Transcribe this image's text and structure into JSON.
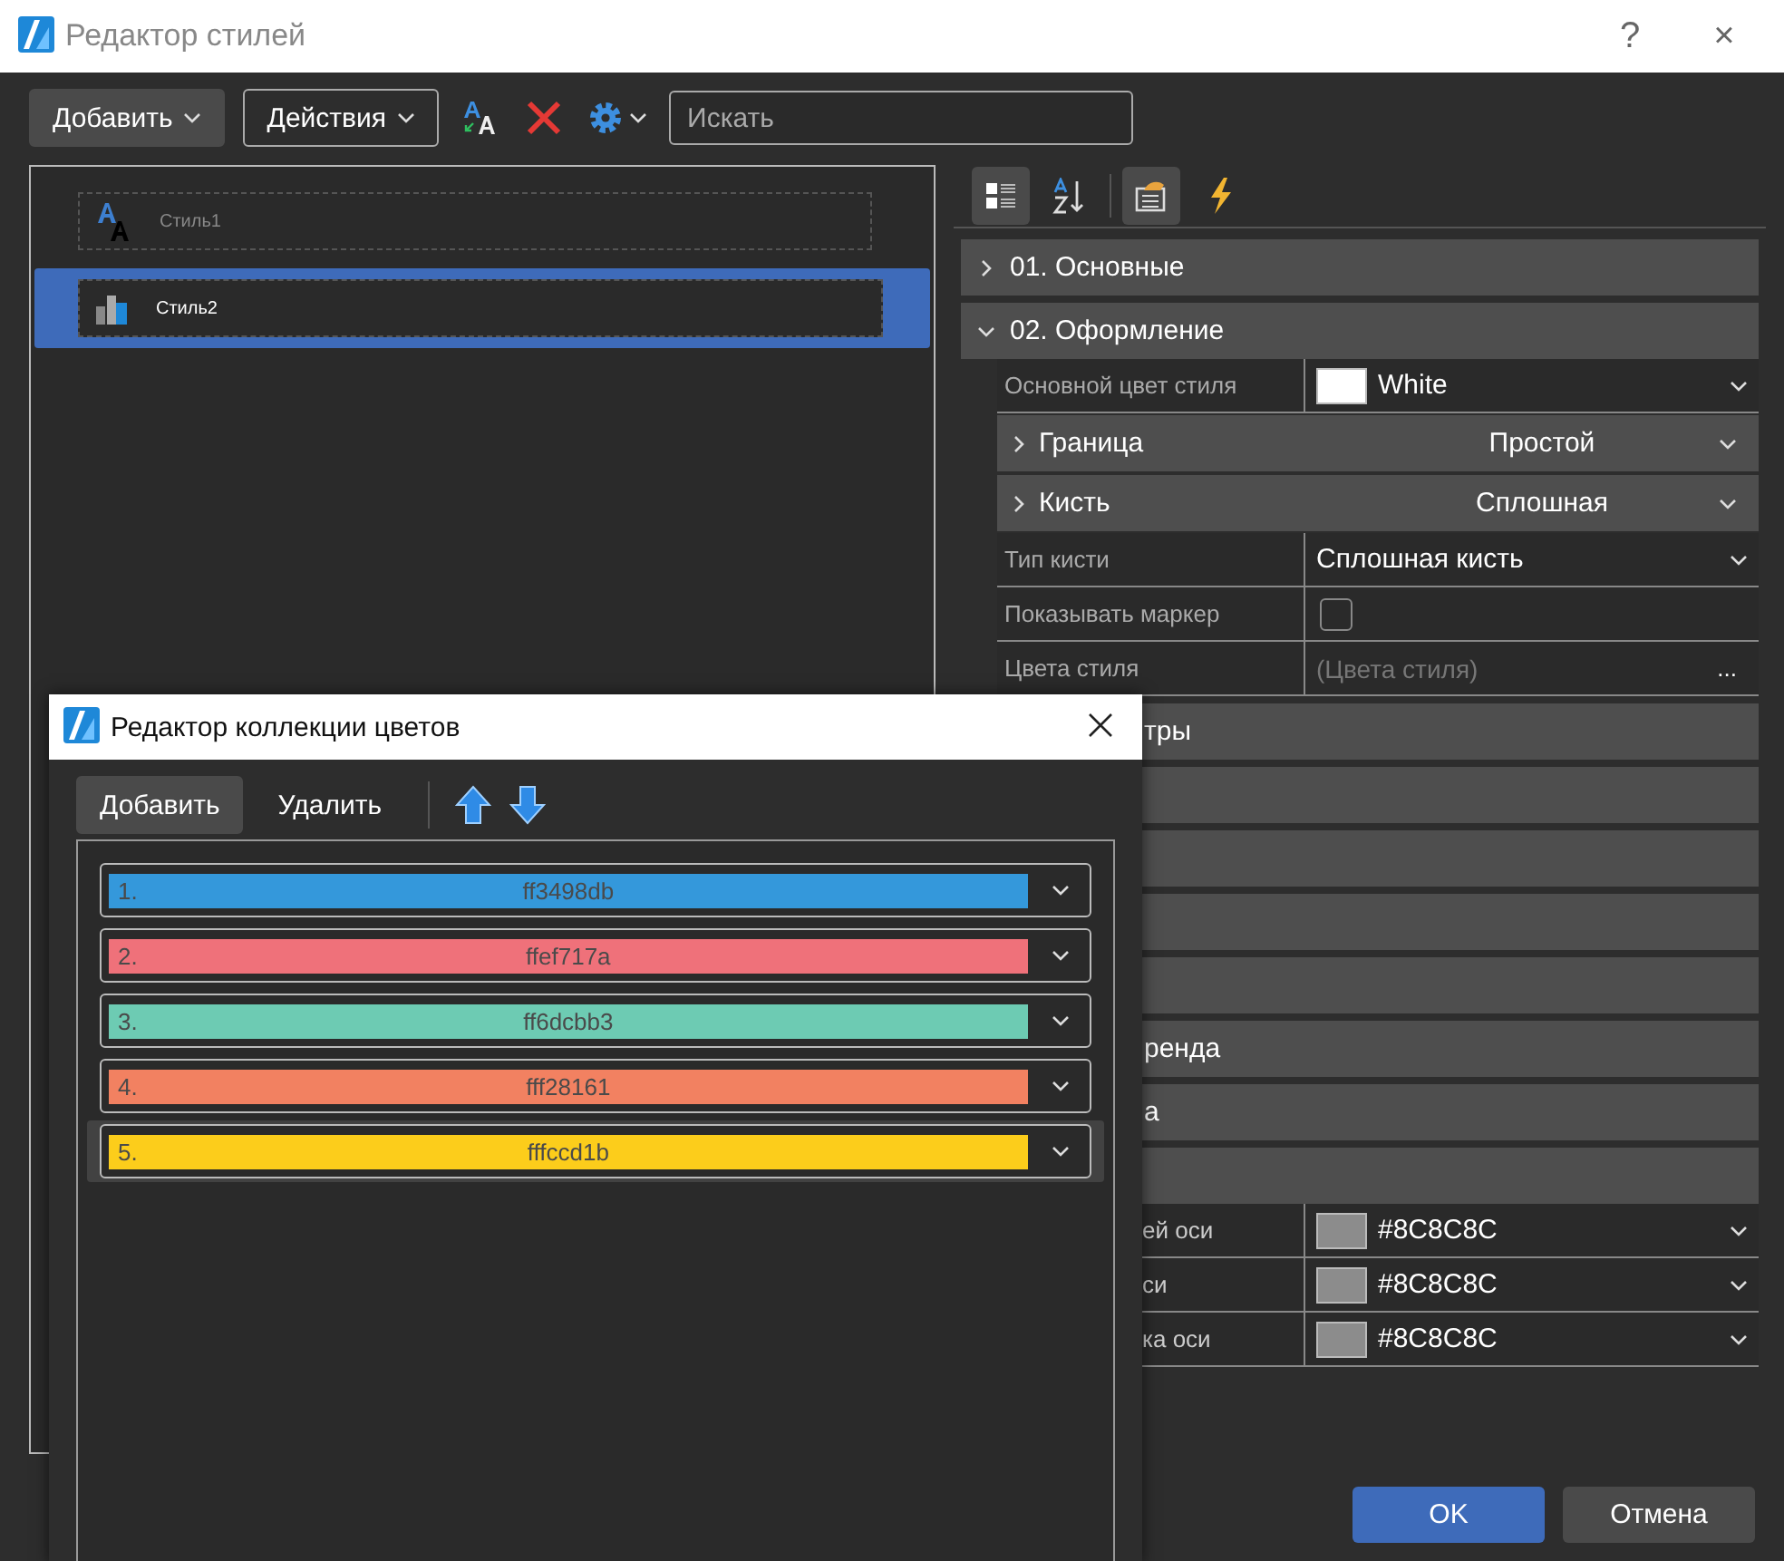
{
  "window": {
    "title": "Редактор стилей",
    "help": "?",
    "close": "×"
  },
  "toolbar": {
    "add": "Добавить",
    "actions": "Действия",
    "search": {
      "placeholder": "Искать"
    }
  },
  "styles": [
    {
      "name": "Стиль1",
      "kind": "text",
      "selected": false
    },
    {
      "name": "Стиль2",
      "kind": "chart",
      "selected": true
    }
  ],
  "property_tools": [
    {
      "kind": "categorized",
      "selected": true
    },
    {
      "kind": "alphabetical",
      "selected": false
    },
    {
      "kind": "properties",
      "selected": true
    },
    {
      "kind": "events",
      "selected": false
    }
  ],
  "categories": [
    {
      "kind": "full",
      "label": "01. Основные",
      "expanded": false
    },
    {
      "kind": "full",
      "label": "02. Оформление",
      "expanded": true,
      "rows": [
        {
          "kind": "color",
          "name": "Основной цвет стиля",
          "color": "#ffffff",
          "value": "White"
        },
        {
          "kind": "group",
          "name": "Граница",
          "value": "Простой"
        },
        {
          "kind": "group",
          "name": "Кисть",
          "value": "Сплошная"
        },
        {
          "kind": "dropdown",
          "name": "Тип кисти",
          "value": "Сплошная кисть"
        },
        {
          "kind": "checkbox",
          "name": "Показывать маркер",
          "checked": false
        },
        {
          "kind": "dialog",
          "name": "Цвета стиля",
          "placeholder": "(Цвета стиля)",
          "button": "..."
        }
      ]
    },
    {
      "kind": "partial",
      "label": "тры"
    },
    {
      "kind": "partial"
    },
    {
      "kind": "partial"
    },
    {
      "kind": "partial"
    },
    {
      "kind": "partial"
    },
    {
      "kind": "partial",
      "label": "ренда"
    },
    {
      "kind": "partial",
      "label": "а"
    },
    {
      "kind": "partial",
      "rows": [
        {
          "kind": "color",
          "name": "ей оси",
          "color": "#8c8c8c",
          "value": "#8C8C8C"
        },
        {
          "kind": "color",
          "name": "си",
          "color": "#8c8c8c",
          "value": "#8C8C8C"
        },
        {
          "kind": "color",
          "name": "ка оси",
          "color": "#8c8c8c",
          "value": "#8C8C8C"
        }
      ]
    }
  ],
  "buttons": {
    "ok": "OK",
    "cancel": "Отмена"
  },
  "dialog": {
    "title": "Редактор коллекции цветов",
    "add": "Добавить",
    "delete": "Удалить",
    "colors": [
      {
        "index": "1.",
        "hex": "ff3498db",
        "color": "#3498db",
        "selected": false
      },
      {
        "index": "2.",
        "hex": "ffef717a",
        "color": "#ef717a",
        "selected": false
      },
      {
        "index": "3.",
        "hex": "ff6dcbb3",
        "color": "#6dcbb3",
        "selected": false
      },
      {
        "index": "4.",
        "hex": "fff28161",
        "color": "#f28161",
        "selected": false
      },
      {
        "index": "5.",
        "hex": "fffccd1b",
        "color": "#fccd1b",
        "selected": true
      }
    ]
  }
}
